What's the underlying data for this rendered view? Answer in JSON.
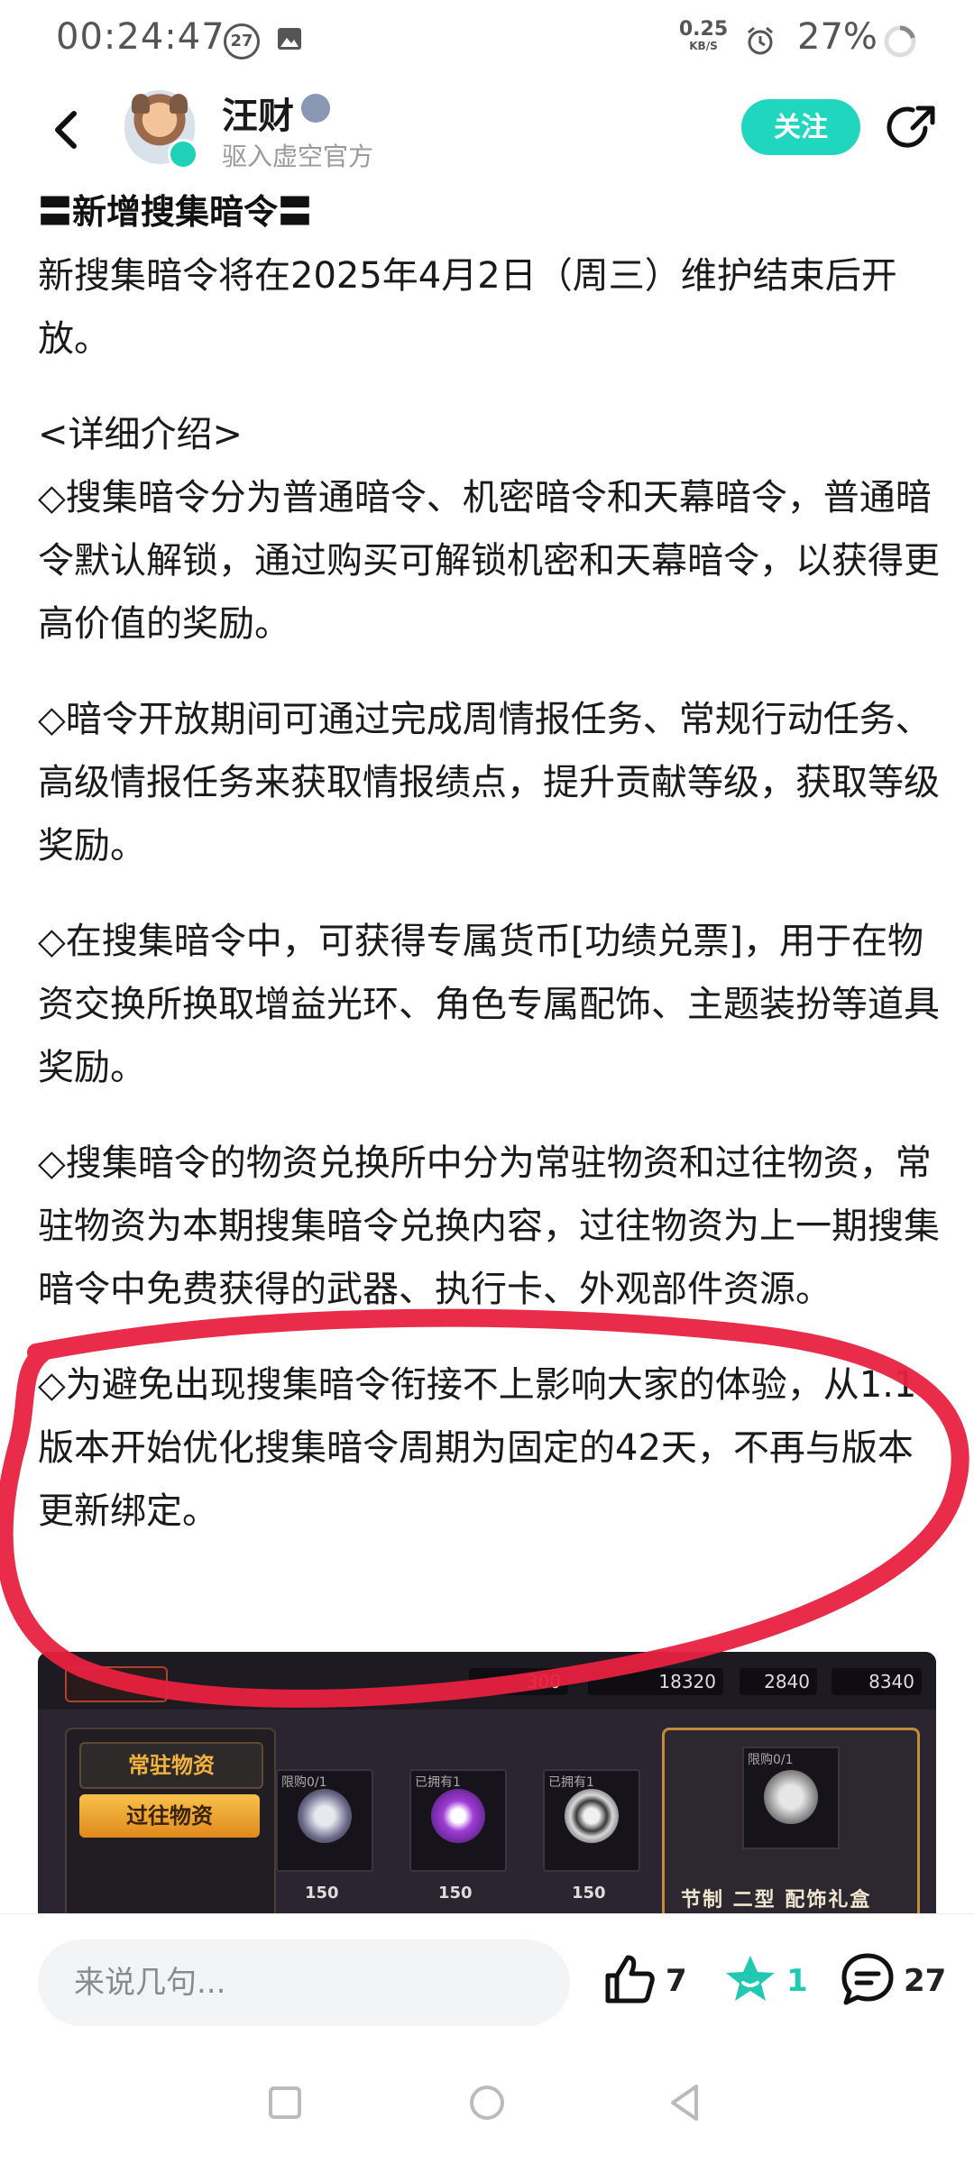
{
  "status_bar": {
    "time": "00:24:47",
    "notification_count": "27",
    "net_speed_value": "0.25",
    "net_speed_unit": "KB/S",
    "battery": "27%"
  },
  "header": {
    "username": "汪财",
    "subtitle": "驱入虚空官方",
    "follow_label": "关注"
  },
  "article": {
    "heading": "〓新增搜集暗令〓",
    "paragraphs": [
      "新搜集暗令将在2025年4月2日（周三）维护结束后开放。",
      "<详细介绍>",
      "◇搜集暗令分为普通暗令、机密暗令和天幕暗令，普通暗令默认解锁，通过购买可解锁机密和天幕暗令，以获得更高价值的奖励。",
      "◇暗令开放期间可通过完成周情报任务、常规行动任务、高级情报任务来获取情报绩点，提升贡献等级，获取等级奖励。",
      "◇在搜集暗令中，可获得专属货币[功绩兑票]，用于在物资交换所换取增益光环、角色专属配饰、主题装扮等道具奖励。",
      "◇搜集暗令的物资兑换所中分为常驻物资和过往物资，常驻物资为本期搜集暗令兑换内容，过往物资为上一期搜集暗令中免费获得的武器、执行卡、外观部件资源。",
      "◇为避免出现搜集暗令衔接不上影响大家的体验，从1.1版本开始优化搜集暗令周期为固定的42天，不再与版本更新绑定。"
    ]
  },
  "game_screenshot": {
    "currency_1": "300",
    "currency_2": "18320",
    "currency_3": "2840",
    "currency_4": "8340",
    "tab_resident": "常驻物资",
    "tab_past": "过往物资",
    "items": [
      {
        "tag": "限购0/1",
        "price": "150"
      },
      {
        "tag": "已拥有1",
        "price": "150"
      },
      {
        "tag": "已拥有1",
        "price": "150"
      }
    ],
    "featured_tag": "限购0/1",
    "featured_caption": "节制 二型 配饰礼盒"
  },
  "bottom_bar": {
    "comment_placeholder": "来说几句...",
    "like_count": "7",
    "favorite_count": "1",
    "comment_count": "27"
  },
  "colors": {
    "accent": "#21d6bf",
    "annotation_red": "#e8213f"
  }
}
